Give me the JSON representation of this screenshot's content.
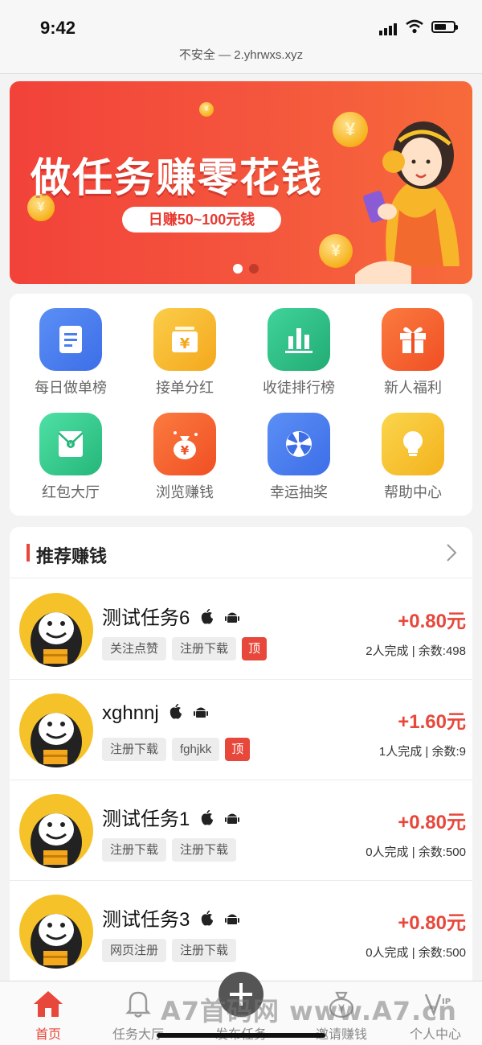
{
  "status": {
    "time": "9:42"
  },
  "browser": {
    "url_text": "不安全 — 2.yhrwxs.xyz"
  },
  "banner": {
    "title": "做任务赚零花钱",
    "subtitle": "日赚50~100元钱",
    "carousel_dots": 2,
    "active_dot": 1
  },
  "grid": {
    "items": [
      {
        "label": "每日做单榜",
        "icon": "document-list-icon",
        "color": "#4a7df0"
      },
      {
        "label": "接单分红",
        "icon": "yuan-box-icon",
        "color": "#f6b52a"
      },
      {
        "label": "收徒排行榜",
        "icon": "bar-chart-icon",
        "color": "#2fbf85"
      },
      {
        "label": "新人福利",
        "icon": "gift-icon",
        "color": "#f6632d"
      },
      {
        "label": "红包大厅",
        "icon": "red-envelope-icon",
        "color": "#3ccb8f"
      },
      {
        "label": "浏览赚钱",
        "icon": "money-bag-icon",
        "color": "#f6632d"
      },
      {
        "label": "幸运抽奖",
        "icon": "lucky-wheel-icon",
        "color": "#4a7df0"
      },
      {
        "label": "帮助中心",
        "icon": "lightbulb-icon",
        "color": "#f6c22a"
      }
    ]
  },
  "recommend": {
    "title": "推荐赚钱",
    "tasks": [
      {
        "name": "测试任务6",
        "tags": [
          "关注点赞",
          "注册下载"
        ],
        "top": true,
        "top_label": "顶",
        "reward": "+0.80元",
        "stats": "2人完成 | 余数:498"
      },
      {
        "name": "xghnnj",
        "tags": [
          "注册下载",
          "fghjkk"
        ],
        "top": true,
        "top_label": "顶",
        "reward": "+1.60元",
        "stats": "1人完成 | 余数:9"
      },
      {
        "name": "测试任务1",
        "tags": [
          "注册下载",
          "注册下载"
        ],
        "top": false,
        "top_label": "",
        "reward": "+0.80元",
        "stats": "0人完成 | 余数:500"
      },
      {
        "name": "测试任务3",
        "tags": [
          "网页注册",
          "注册下载"
        ],
        "top": false,
        "top_label": "",
        "reward": "+0.80元",
        "stats": "0人完成 | 余数:500"
      }
    ]
  },
  "tabbar": {
    "items": [
      {
        "label": "首页",
        "icon": "home-icon",
        "active": true
      },
      {
        "label": "任务大厅",
        "icon": "bell-icon",
        "active": false
      },
      {
        "label": "发布任务",
        "icon": "plus-icon",
        "active": false
      },
      {
        "label": "邀请赚钱",
        "icon": "money-bag-icon",
        "active": false
      },
      {
        "label": "个人中心",
        "icon": "vip-icon",
        "active": false
      }
    ]
  },
  "watermark": "A7首码网 www.A7.cn",
  "colors": {
    "accent": "#e8473b",
    "banner": "#f2423a"
  }
}
